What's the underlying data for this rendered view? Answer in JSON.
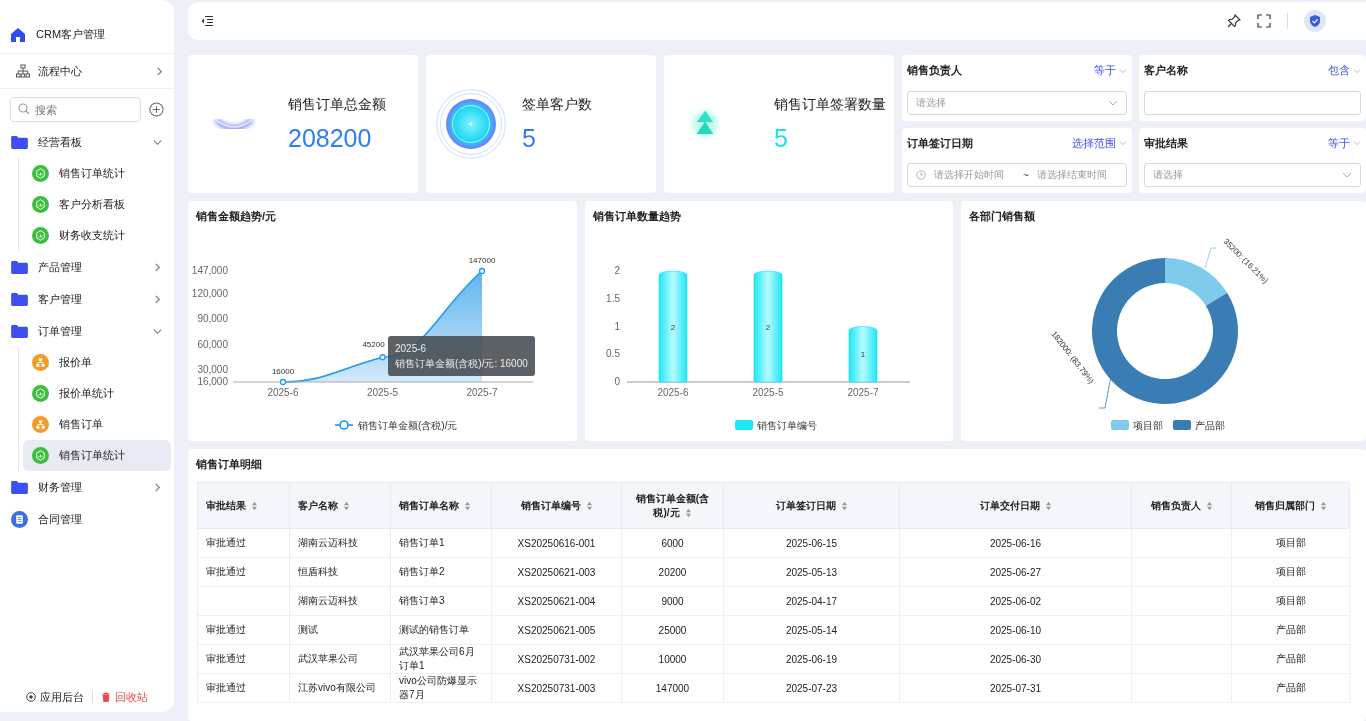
{
  "sidebar": {
    "brand": "CRM客户管理",
    "flow_center": "流程中心",
    "search": {
      "placeholder": "搜索"
    },
    "menu": [
      {
        "label": "经营看板",
        "kind": "folder",
        "expanded": true,
        "children": [
          {
            "label": "销售订单统计",
            "kind": "report",
            "selected": false
          },
          {
            "label": "客户分析看板",
            "kind": "report",
            "selected": false
          },
          {
            "label": "财务收支统计",
            "kind": "report",
            "selected": false
          }
        ]
      },
      {
        "label": "产品管理",
        "kind": "folder",
        "expanded": false
      },
      {
        "label": "客户管理",
        "kind": "folder",
        "expanded": false
      },
      {
        "label": "订单管理",
        "kind": "folder",
        "expanded": true,
        "children": [
          {
            "label": "报价单",
            "kind": "form",
            "selected": false
          },
          {
            "label": "报价单统计",
            "kind": "report",
            "selected": false
          },
          {
            "label": "销售订单",
            "kind": "form",
            "selected": false
          },
          {
            "label": "销售订单统计",
            "kind": "report",
            "selected": true
          }
        ]
      },
      {
        "label": "财务管理",
        "kind": "folder",
        "expanded": false
      },
      {
        "label": "合同管理",
        "kind": "document"
      }
    ],
    "footer": {
      "admin": "应用后台",
      "recycle": "回收站"
    }
  },
  "kpis": [
    {
      "label": "销售订单总金额",
      "value": "208200",
      "kind": "arc",
      "color": "#2f7df6"
    },
    {
      "label": "签单客户数",
      "value": "5",
      "kind": "orb",
      "color": "#2f7df6"
    },
    {
      "label": "销售订单签署数量",
      "value": "5",
      "kind": "arrows",
      "color": "#19e3e8"
    }
  ],
  "filters": [
    {
      "label": "销售负责人",
      "operator": "等于",
      "kind": "select",
      "placeholder": "请选择"
    },
    {
      "label": "客户名称",
      "operator": "包含",
      "kind": "text"
    },
    {
      "label": "订单签订日期",
      "operator": "选择范围",
      "kind": "daterange",
      "start_placeholder": "请选择开始时间",
      "separator": "~",
      "end_placeholder": "请选择结束时间"
    },
    {
      "label": "审批结果",
      "operator": "等于",
      "kind": "select",
      "placeholder": "请选择"
    }
  ],
  "amount_trend": {
    "title": "销售金额趋势/元",
    "chart_data": {
      "type": "area",
      "categories": [
        "2025-6",
        "2025-5",
        "2025-7"
      ],
      "series": [
        {
          "name": "销售订单金额(含税)/元",
          "color": "#1e9bf0",
          "marker": "circle",
          "values": [
            16000,
            45200,
            147000
          ]
        }
      ],
      "ylim": [
        16000,
        147000
      ],
      "legend": "bottom",
      "yticks": [
        {
          "value": 16000,
          "label": "16,000"
        },
        {
          "value": 30000,
          "label": "30,000"
        },
        {
          "value": 60000,
          "label": "60,000"
        },
        {
          "value": 90000,
          "label": "90,000"
        },
        {
          "value": 120000,
          "label": "120,000"
        },
        {
          "value": 147000,
          "label": "147,000"
        }
      ],
      "data_labels": true
    },
    "tooltip": {
      "title": "2025-6",
      "text": "销售订单金额(含税)/元: 16000"
    }
  },
  "count_trend": {
    "title": "销售订单数量趋势",
    "chart_data": {
      "type": "bar",
      "categories": [
        "2025-6",
        "2025-5",
        "2025-7"
      ],
      "series": [
        {
          "name": "销售订单编号",
          "color": "#1de6f7",
          "values": [
            2,
            2,
            1
          ]
        }
      ],
      "yticks": [
        0,
        0.5,
        1,
        1.5,
        2
      ],
      "ylim": [
        0,
        2
      ],
      "legend": "bottom",
      "data_labels": true
    }
  },
  "dept_sales": {
    "title": "各部门销售额",
    "chart_data": {
      "type": "donut",
      "categories": [
        "项目部",
        "产品部"
      ],
      "values": [
        35200,
        182000
      ],
      "colors": [
        "#7ecbeb",
        "#3a7db5"
      ],
      "legend": "bottom",
      "value_labels": [
        "35200: (16.21%)",
        "182000: (83.79%)"
      ]
    }
  },
  "table": {
    "title": "销售订单明细",
    "columns": [
      "审批结果",
      "客户名称",
      "销售订单名称",
      "销售订单编号",
      "销售订单金额(含税)/元",
      "订单签订日期",
      "订单交付日期",
      "销售负责人",
      "销售归属部门"
    ],
    "rows": [
      [
        "审批通过",
        "湖南云迈科技",
        "销售订单1",
        "XS20250616-001",
        "6000",
        "2025-06-15",
        "2025-06-16",
        null,
        "项目部"
      ],
      [
        "审批通过",
        "恒盾科技",
        "销售订单2",
        "XS20250621-003",
        "20200",
        "2025-05-13",
        "2025-06-27",
        null,
        "项目部"
      ],
      [
        null,
        "湖南云迈科技",
        "销售订单3",
        "XS20250621-004",
        "9000",
        "2025-04-17",
        "2025-06-02",
        null,
        "项目部"
      ],
      [
        "审批通过",
        "测试",
        "测试的销售订单",
        "XS20250621-005",
        "25000",
        "2025-05-14",
        "2025-06-10",
        null,
        "产品部"
      ],
      [
        "审批通过",
        "武汉苹果公司",
        "武汉苹果公司6月订单1",
        "XS20250731-002",
        "10000",
        "2025-06-19",
        "2025-06-30",
        null,
        "产品部"
      ],
      [
        "审批通过",
        "江苏vivo有限公司",
        "vivo公司防爆显示器7月",
        "XS20250731-003",
        "147000",
        "2025-07-23",
        "2025-07-31",
        null,
        "产品部"
      ]
    ]
  }
}
